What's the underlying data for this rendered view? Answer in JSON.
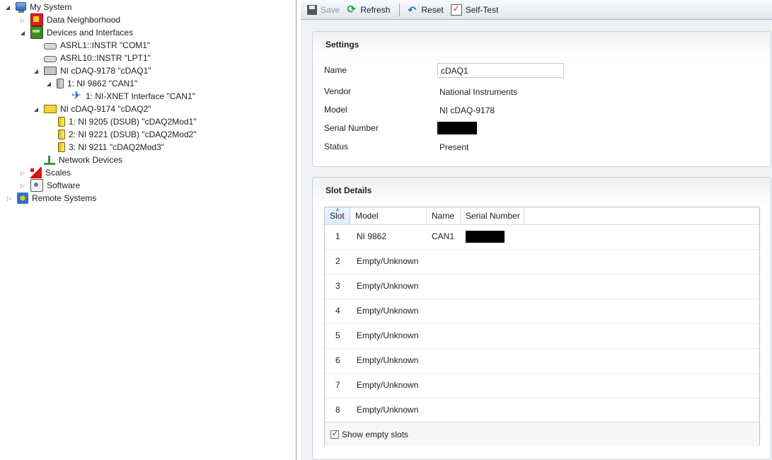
{
  "tree": {
    "items": [
      {
        "label": "My System",
        "icon": "monitor-icon",
        "expander": "expanded"
      },
      {
        "label": "Data Neighborhood",
        "icon": "data-neighborhood-icon",
        "expander": "collapsed"
      },
      {
        "label": "Devices and Interfaces",
        "icon": "devices-interfaces-icon",
        "expander": "expanded"
      },
      {
        "label": "ASRL1::INSTR \"COM1\"",
        "icon": "serial-port-icon",
        "expander": "none"
      },
      {
        "label": "ASRL10::INSTR \"LPT1\"",
        "icon": "serial-port-icon",
        "expander": "none"
      },
      {
        "label": "NI cDAQ-9178 \"cDAQ1\"",
        "icon": "chassis-icon",
        "expander": "expanded"
      },
      {
        "label": "1: NI 9862 \"CAN1\"",
        "icon": "module-icon",
        "expander": "expanded"
      },
      {
        "label": "1: NI-XNET Interface \"CAN1\"",
        "icon": "xnet-icon",
        "expander": "none"
      },
      {
        "label": "NI cDAQ-9174 \"cDAQ2\"",
        "icon": "chassis-icon",
        "expander": "expanded"
      },
      {
        "label": "1: NI 9205 (DSUB) \"cDAQ2Mod1\"",
        "icon": "module-icon",
        "expander": "none"
      },
      {
        "label": "2: NI 9221 (DSUB) \"cDAQ2Mod2\"",
        "icon": "module-icon",
        "expander": "none"
      },
      {
        "label": "3: NI 9211 \"cDAQ2Mod3\"",
        "icon": "module-icon",
        "expander": "none"
      },
      {
        "label": "Network Devices",
        "icon": "network-devices-icon",
        "expander": "none"
      },
      {
        "label": "Scales",
        "icon": "scales-icon",
        "expander": "collapsed"
      },
      {
        "label": "Software",
        "icon": "software-icon",
        "expander": "collapsed"
      },
      {
        "label": "Remote Systems",
        "icon": "remote-systems-icon",
        "expander": "collapsed"
      }
    ]
  },
  "toolbar": {
    "save_label": "Save",
    "refresh_label": "Refresh",
    "reset_label": "Reset",
    "selftest_label": "Self-Test"
  },
  "settings": {
    "title": "Settings",
    "name_label": "Name",
    "name_value": "cDAQ1",
    "vendor_label": "Vendor",
    "vendor_value": "National Instruments",
    "model_label": "Model",
    "model_value": "NI cDAQ-9178",
    "serial_label": "Serial Number",
    "status_label": "Status",
    "status_value": "Present"
  },
  "slot_details": {
    "title": "Slot Details",
    "columns": [
      "Slot",
      "Model",
      "Name",
      "Serial Number"
    ],
    "rows": [
      {
        "slot": "1",
        "model": "NI 9862",
        "name": "CAN1"
      },
      {
        "slot": "2",
        "model": "Empty/Unknown",
        "name": ""
      },
      {
        "slot": "3",
        "model": "Empty/Unknown",
        "name": ""
      },
      {
        "slot": "4",
        "model": "Empty/Unknown",
        "name": ""
      },
      {
        "slot": "5",
        "model": "Empty/Unknown",
        "name": ""
      },
      {
        "slot": "6",
        "model": "Empty/Unknown",
        "name": ""
      },
      {
        "slot": "7",
        "model": "Empty/Unknown",
        "name": ""
      },
      {
        "slot": "8",
        "model": "Empty/Unknown",
        "name": ""
      }
    ],
    "show_empty_label": "Show empty slots",
    "show_empty_checked": true
  }
}
